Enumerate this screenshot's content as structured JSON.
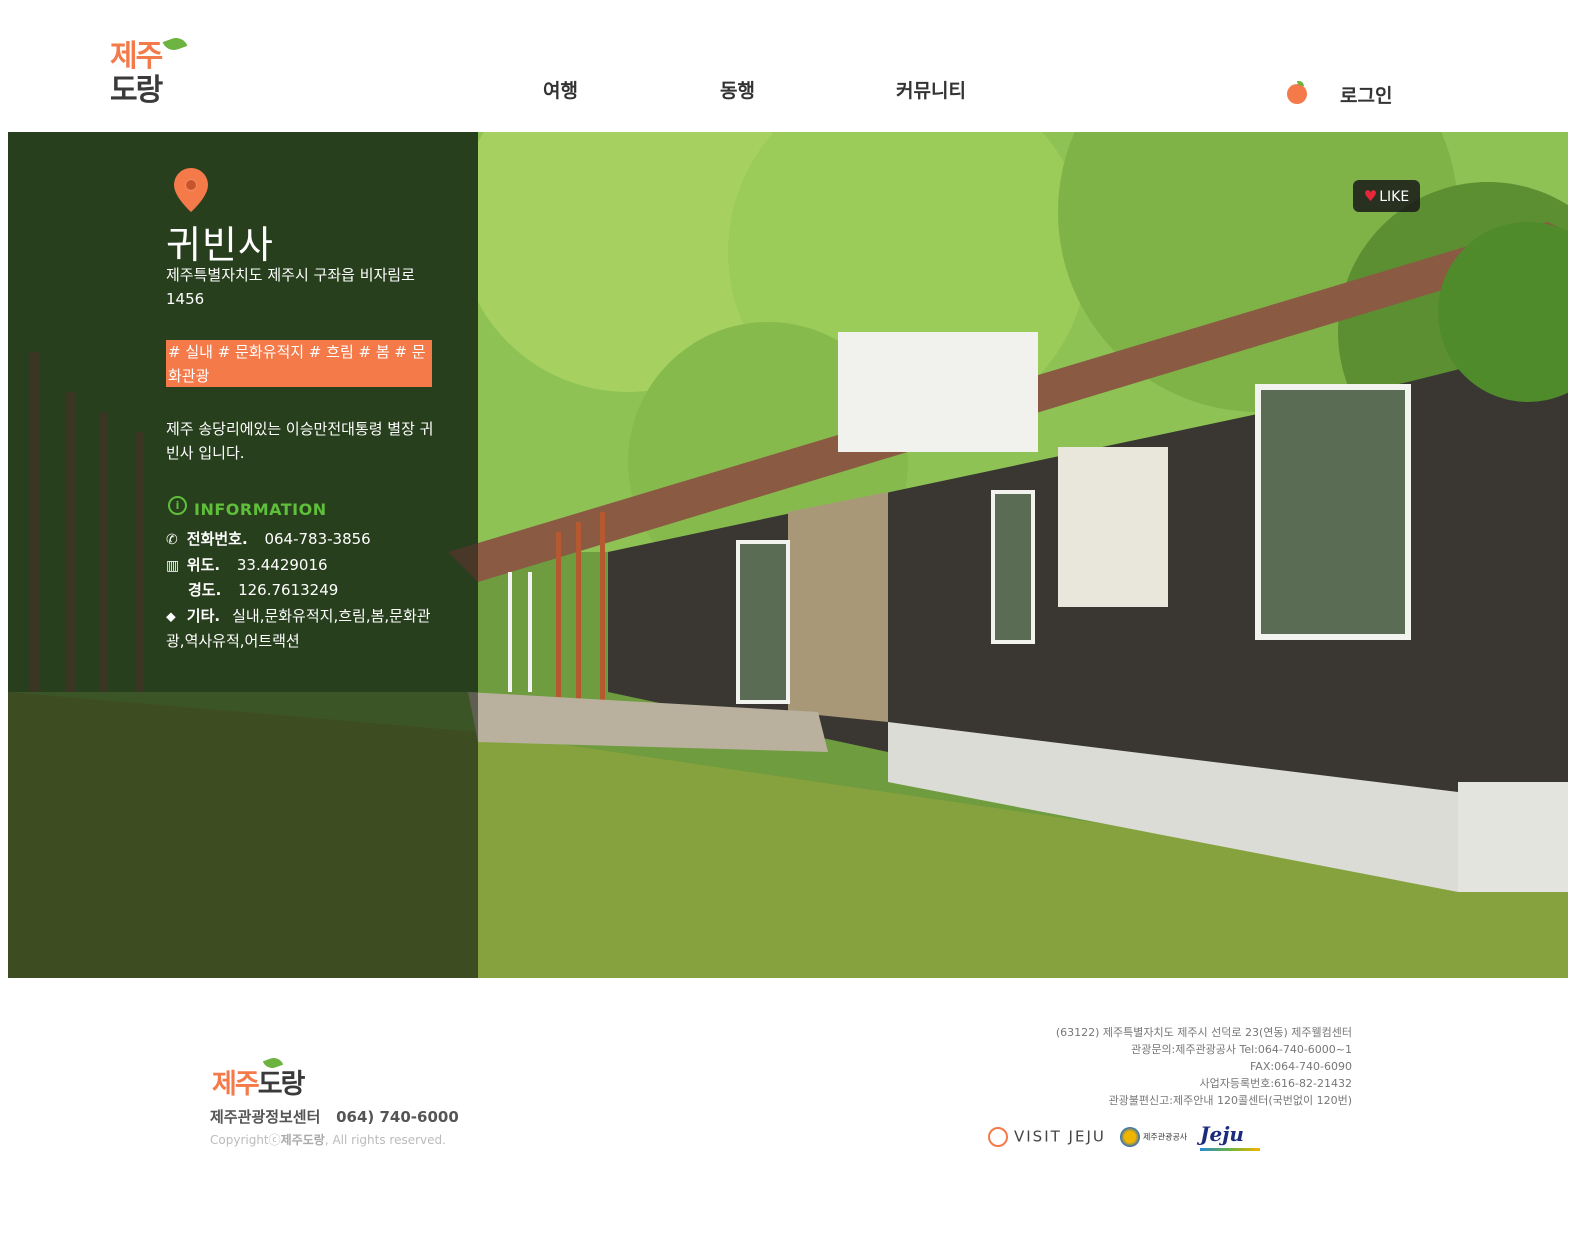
{
  "header": {
    "logo_line1": "제주",
    "logo_line2": "도랑",
    "nav": [
      "여행",
      "동행",
      "커뮤니티"
    ],
    "login": "로그인"
  },
  "place": {
    "title": "귀빈사",
    "address": "제주특별자치도 제주시 구좌읍 비자림로 1456",
    "tags": "# 실내 # 문화유적지 # 흐림 # 봄 # 문화관광",
    "description": "제주 송당리에있는 이승만전대통령 별장 귀빈사 입니다.",
    "info_heading": "INFORMATION",
    "phone_label": "전화번호.",
    "phone": "064-783-3856",
    "lat_label": "위도.",
    "lat": "33.4429016",
    "lng_label": "경도.",
    "lng": "126.7613249",
    "etc_label": "기타.",
    "etc": "실내,문화유적지,흐림,봄,문화관광,역사유적,어트랙션"
  },
  "like": {
    "label": "LIKE"
  },
  "footer": {
    "logo_a": "제주",
    "logo_b": "도랑",
    "center_name": "제주관광정보센터",
    "center_phone": "064) 740-6000",
    "copyright_pre": "Copyright",
    "copyright_brand": "제주도랑",
    "copyright_post": ", All rights reserved.",
    "address_lines": [
      "(63122) 제주특별자치도 제주시 선덕로 23(연동) 제주웰컴센터",
      "관광문의:제주관광공사 Tel:064-740-6000~1",
      "FAX:064-740-6090",
      "사업자등록번호:616-82-21432",
      "관광불편신고:제주안내 120콜센터(국번없이 120번)"
    ],
    "partners": {
      "visit_jeju": "VISIT JEJU",
      "jto": "제주관광공사",
      "jeju": "Jeju"
    }
  },
  "colors": {
    "accent": "#f47a4a",
    "leaf_green": "#6cb33f",
    "info_green": "#5fbf3a"
  }
}
